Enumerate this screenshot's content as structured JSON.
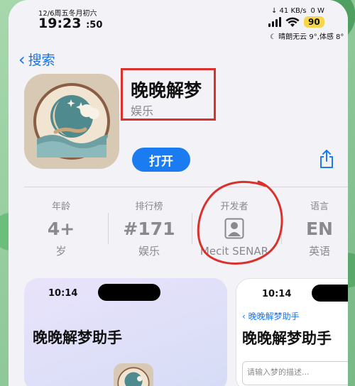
{
  "status_bar": {
    "date": "12/6周五冬月初六",
    "time": "19:23",
    "seconds": ":50",
    "net_speed": "↓ 41 KB/s",
    "data_rate": "0 W",
    "battery": "90",
    "weather": "晴朗无云 9°,体感 8°"
  },
  "nav": {
    "back_label": "搜索"
  },
  "app": {
    "title": "晚晚解梦",
    "subtitle": "娱乐",
    "open_label": "打开"
  },
  "info": {
    "age": {
      "label": "年龄",
      "value": "4+",
      "sub": "岁"
    },
    "rank": {
      "label": "排行榜",
      "value": "#171",
      "sub": "娱乐"
    },
    "developer": {
      "label": "开发者",
      "sub": "Mecit SENAR"
    },
    "language": {
      "label": "语言",
      "value": "EN",
      "sub": "英语"
    }
  },
  "screenshots": {
    "shot1": {
      "time": "10:14",
      "title": "晚晚解梦助手"
    },
    "shot2": {
      "time": "10:14",
      "back": "晚晚解梦助手",
      "title": "晚晚解梦助手",
      "input_placeholder": "请输入梦的描述..."
    }
  },
  "colors": {
    "accent": "#1a7cf0",
    "annotation_red": "#d9322c",
    "battery_badge": "#f5d64c"
  }
}
